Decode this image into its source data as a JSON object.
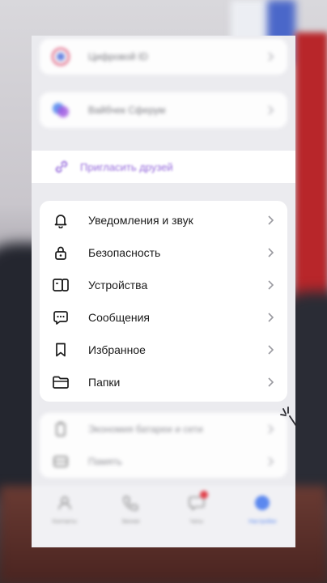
{
  "top_cards": [
    {
      "label": "Цифровой ID",
      "icon": "id-icon"
    },
    {
      "label": "Вайбчек Сферум",
      "icon": "sferum-icon"
    }
  ],
  "invite": {
    "label": "Пригласить друзей",
    "icon": "link-icon"
  },
  "settings": {
    "items": [
      {
        "label": "Уведомления и звук",
        "icon": "bell-icon"
      },
      {
        "label": "Безопасность",
        "icon": "lock-icon"
      },
      {
        "label": "Устройства",
        "icon": "devices-icon"
      },
      {
        "label": "Сообщения",
        "icon": "chat-icon"
      },
      {
        "label": "Избранное",
        "icon": "bookmark-icon"
      },
      {
        "label": "Папки",
        "icon": "folder-icon"
      }
    ]
  },
  "lower_items": [
    {
      "label": "Экономия батареи и сети",
      "icon": "battery-icon"
    },
    {
      "label": "Память",
      "icon": "storage-icon"
    }
  ],
  "tabbar": [
    {
      "label": "Контакты",
      "icon": "contacts-icon"
    },
    {
      "label": "Звонки",
      "icon": "phone-icon"
    },
    {
      "label": "Чаты",
      "icon": "chats-icon"
    },
    {
      "label": "Настройки",
      "icon": "profile-icon"
    }
  ],
  "colors": {
    "accent": "#8a5ad8",
    "badge": "#e0303a",
    "active_tab": "#4c7ef0"
  }
}
